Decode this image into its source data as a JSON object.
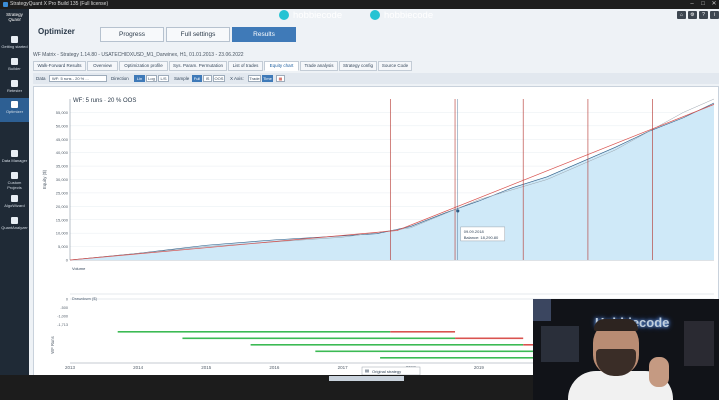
{
  "app": {
    "title": "StrategyQuant X Pro Build 135 (Full license)",
    "brand_line1": "Strategy",
    "brand_line2": "Quant"
  },
  "window_controls": [
    "minimize-icon",
    "maximize-icon",
    "close-icon"
  ],
  "nav": {
    "items": [
      {
        "label": "Getting started",
        "icon": "home-icon",
        "active": false
      },
      {
        "label": "Builder",
        "icon": "plus-icon",
        "active": false
      },
      {
        "label": "Retester",
        "icon": "filter-icon",
        "active": false
      },
      {
        "label": "Optimizer",
        "icon": "chart-icon",
        "active": true
      },
      {
        "label": "Data Manager",
        "icon": "database-icon",
        "active": false
      },
      {
        "label": "Custom Projects",
        "icon": "document-icon",
        "active": false
      },
      {
        "label": "AlgoWizard",
        "icon": "wand-icon",
        "active": false
      },
      {
        "label": "QuantAnalyzer",
        "icon": "toolbox-icon",
        "active": false
      }
    ]
  },
  "main": {
    "title": "Optimizer",
    "tabs": [
      {
        "label": "Progress",
        "active": false
      },
      {
        "label": "Full settings",
        "active": false
      },
      {
        "label": "Results",
        "active": true
      }
    ],
    "wf_title": "WF Matrix - Strategy 1.14.80 - USATECHIDXUSD_M1_Darwinex, H1, 01.01.2013 - 23.06.2022",
    "subtabs": [
      {
        "label": "Walk-Forward Results",
        "active": false
      },
      {
        "label": "Overview",
        "active": false
      },
      {
        "label": "Optimization profile",
        "active": false
      },
      {
        "label": "Sys. Param. Permutation",
        "active": false
      },
      {
        "label": "List of trades",
        "active": false
      },
      {
        "label": "Equity chart",
        "active": true
      },
      {
        "label": "Trade analysis",
        "active": false
      },
      {
        "label": "Strategy config",
        "active": false
      },
      {
        "label": "Source Code",
        "active": false
      }
    ],
    "toolbar": {
      "data_label": "Data",
      "data_value": "WF: 5 runs - 20 % ...",
      "direction_label": "Direction",
      "direction_options": [
        {
          "label": "Lin",
          "on": true
        },
        {
          "label": "Log",
          "on": false
        },
        {
          "label": "L/S",
          "on": false
        }
      ],
      "sample_label": "Sample",
      "sample_options": [
        {
          "label": "Full",
          "on": true
        },
        {
          "label": "IS",
          "on": false
        },
        {
          "label": "OOS",
          "on": false
        }
      ],
      "xaxis_label": "X Axis:",
      "xaxis_options": [
        {
          "label": "Trade",
          "on": false
        },
        {
          "label": "Time",
          "on": true
        }
      ]
    }
  },
  "chart_data": {
    "type": "line",
    "title": "WF: 5 runs · 20 % OOS",
    "ylabel": "Equity ($)",
    "ylim": [
      0,
      60000
    ],
    "y_ticks": [
      "0",
      "5,000",
      "10,000",
      "15,000",
      "20,000",
      "25,000",
      "30,000",
      "35,000",
      "40,000",
      "45,000",
      "50,000",
      "55,000"
    ],
    "x_labels": [
      "2013",
      "2014",
      "2015",
      "2016",
      "2017",
      "2018",
      "2019",
      "2020",
      "2021",
      "2022"
    ],
    "tooltip": {
      "date": "09.09.2018",
      "balance": "Balance: 18,290.80"
    },
    "equity": {
      "x": [
        2013.0,
        2014.0,
        2015.0,
        2016.0,
        2017.0,
        2017.5,
        2018.0,
        2018.5,
        2019.0,
        2019.5,
        2020.0,
        2020.5,
        2021.0,
        2021.5,
        2022.0,
        2022.45
      ],
      "y": [
        0,
        2500,
        5500,
        7500,
        9000,
        9800,
        12500,
        17500,
        22000,
        27000,
        31000,
        36500,
        42000,
        48000,
        53000,
        58500
      ]
    },
    "original_strategy": {
      "x": [
        2013.0,
        2015.0,
        2017.0,
        2018.0,
        2019.0,
        2020.0,
        2021.0,
        2022.0,
        2022.45
      ],
      "y": [
        0,
        5000,
        8500,
        12000,
        22500,
        30000,
        41000,
        55000,
        60000
      ]
    },
    "trend_line": {
      "x": [
        2013.0,
        2017.8,
        2022.45
      ],
      "y": [
        0,
        11000,
        58000
      ]
    },
    "oos_period_starts": [
      2017.7,
      2018.65,
      2019.65,
      2020.6,
      2021.55
    ],
    "volume_label": "Volume",
    "drawdown_label": "Drawdown ($)",
    "drawdown_ticks": [
      "0",
      "-500",
      "-1,000",
      "-1,713"
    ],
    "wf_runs_label": "WF Runs",
    "legend_label": "Original strategy"
  },
  "social": {
    "instagram": "hobbiecode",
    "youtube": "hobbiecode"
  },
  "webcam": {
    "neon_text": "Hobbiecode"
  },
  "colors": {
    "nav_bg": "#1f2a36",
    "accent": "#3f7ab8",
    "equity_fill": "#cfe9f8",
    "trend": "#d9534f",
    "oos_line": "#b3302b"
  }
}
